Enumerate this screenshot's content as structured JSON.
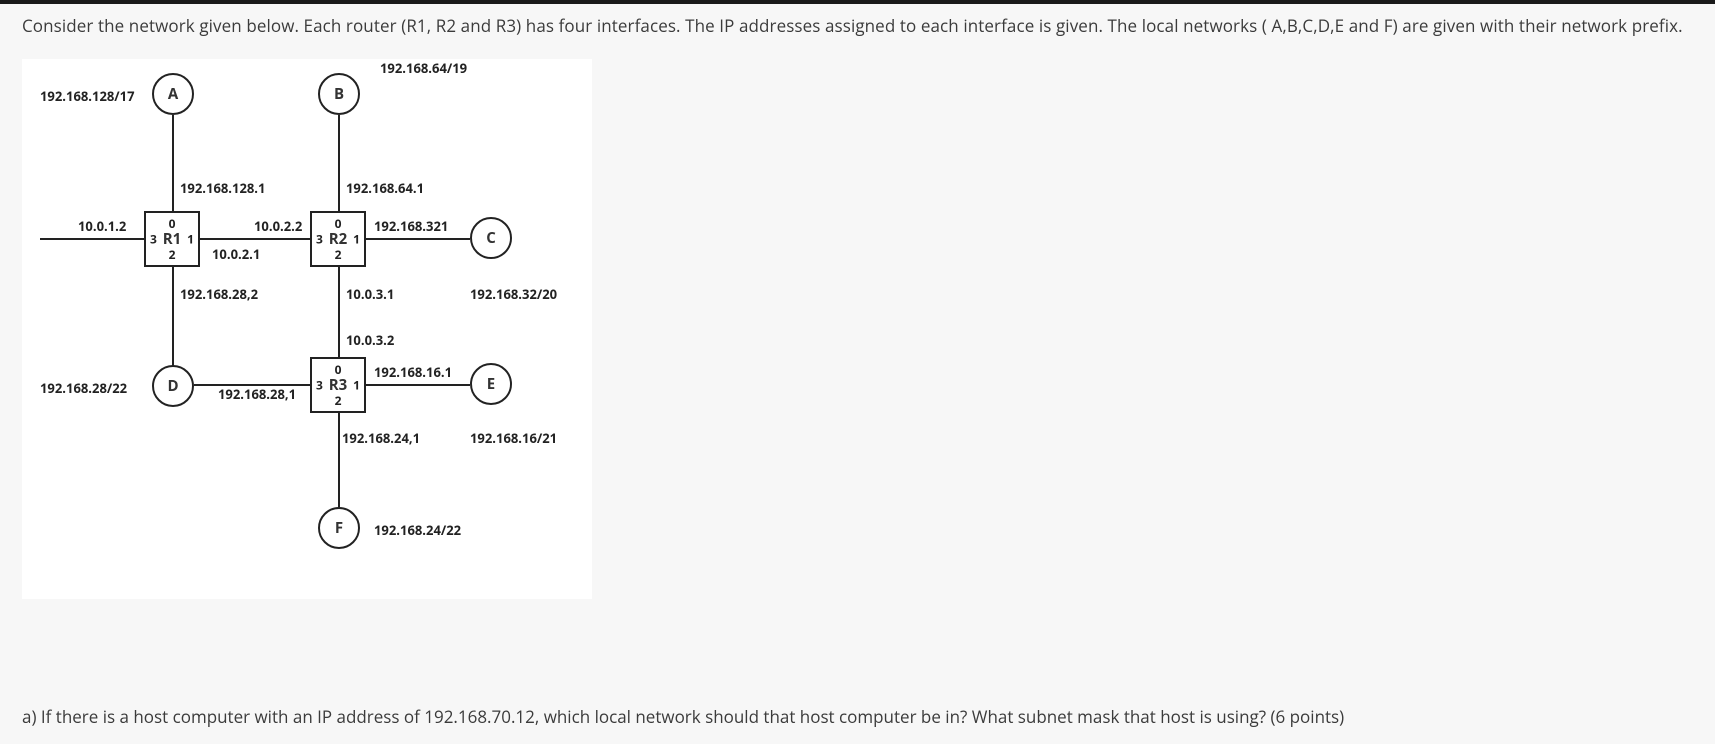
{
  "question": {
    "intro": "Consider the network given below. Each router (R1, R2 and R3) has four interfaces. The IP addresses assigned to each interface is given. The local networks ( A,B,C,D,E and F) are given with their network prefix.",
    "partA": "a) If there is a host computer with an IP address of 192.168.70.12, which local network should that host computer be in? What subnet mask that host is using? (6 points)"
  },
  "networks": {
    "A": {
      "label": "A",
      "prefix": "192.168.128/17"
    },
    "B": {
      "label": "B",
      "prefix": "192.168.64/19"
    },
    "C": {
      "label": "C",
      "prefix": "192.168.32/20"
    },
    "D": {
      "label": "D",
      "prefix": "192.168.28/22"
    },
    "E": {
      "label": "E",
      "prefix": "192.168.16/21"
    },
    "F": {
      "label": "F",
      "prefix": "192.168.24/22"
    }
  },
  "routers": {
    "R1": {
      "label": "R1",
      "ports": {
        "p0": "0",
        "p1": "1",
        "p2": "2",
        "p3": "3"
      },
      "if0": "192.168.128.1",
      "if1": "10.0.2.1",
      "if2": "192.168.28,2",
      "if3": "10.0.1.2"
    },
    "R2": {
      "label": "R2",
      "ports": {
        "p0": "0",
        "p1": "1",
        "p2": "2",
        "p3": "3"
      },
      "if0": "192.168.64.1",
      "if1": "192.168.321",
      "if2": "10.0.3.1",
      "if3": "10.0.2.2"
    },
    "R3": {
      "label": "R3",
      "ports": {
        "p0": "0",
        "p1": "1",
        "p2": "2",
        "p3": "3"
      },
      "if0": "10.0.3.2",
      "if1": "192.168.16.1",
      "if2": "192.168.24,1",
      "if3": "192.168.28,1"
    }
  }
}
